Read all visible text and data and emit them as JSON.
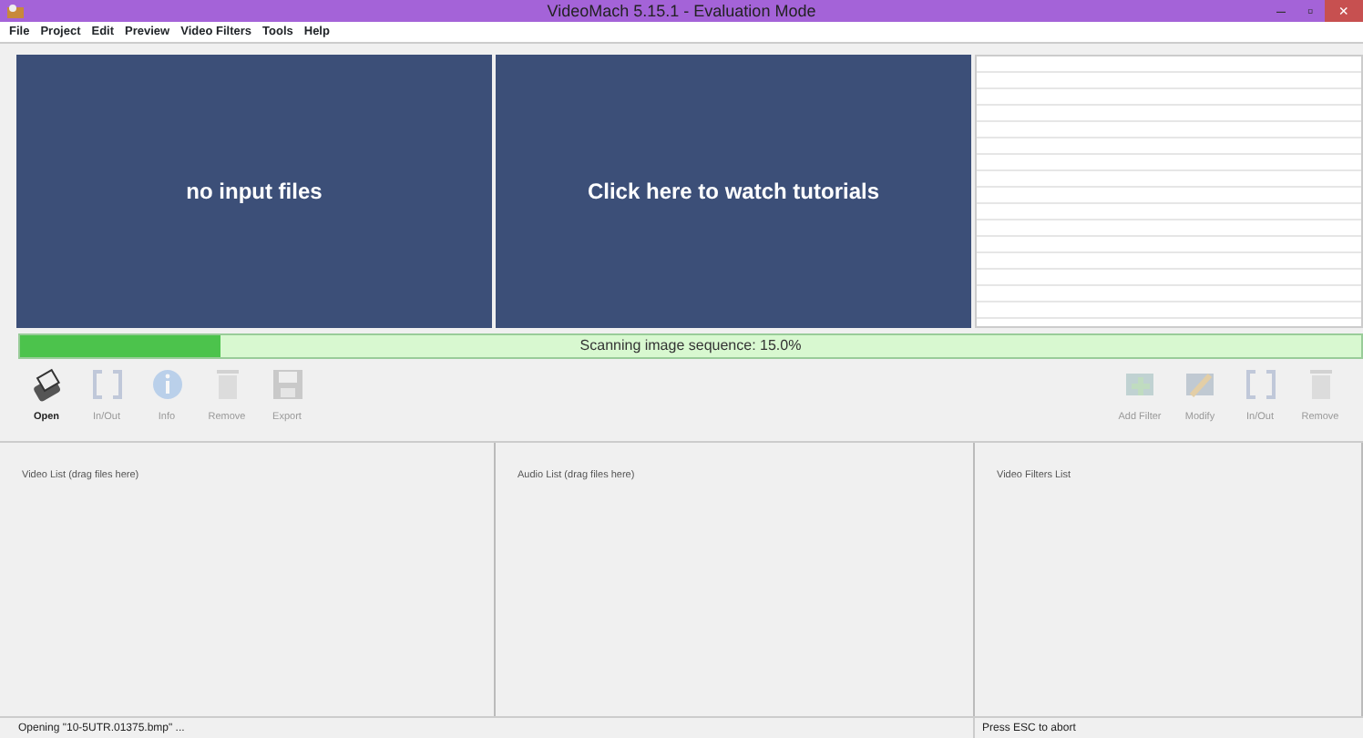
{
  "window": {
    "title": "VideoMach 5.15.1 - Evaluation Mode",
    "controls": [
      "–",
      "▫",
      "×"
    ]
  },
  "menu": [
    "File",
    "Project",
    "Edit",
    "Preview",
    "Video Filters",
    "Tools",
    "Help"
  ],
  "previews": [
    {
      "text": "no input files"
    },
    {
      "text": "Click here to watch tutorials"
    }
  ],
  "progress": {
    "level": 0.15,
    "text": "Scanning image sequence: 15.0%"
  },
  "toolbar_left": [
    {
      "label": "Open",
      "kind": "open",
      "disabled": false
    },
    {
      "label": "In/Out",
      "kind": "inout",
      "disabled": true
    },
    {
      "label": "Info",
      "kind": "info",
      "disabled": true
    },
    {
      "label": "Remove",
      "kind": "remove",
      "disabled": true
    },
    {
      "label": "Export",
      "kind": "export",
      "disabled": true
    }
  ],
  "toolbar_right": [
    {
      "label": "Add Filter",
      "kind": "addfilter",
      "disabled": true
    },
    {
      "label": "Modify",
      "kind": "modify",
      "disabled": true
    },
    {
      "label": "In/Out",
      "kind": "inout",
      "disabled": true
    },
    {
      "label": "Remove",
      "kind": "remove",
      "disabled": true
    }
  ],
  "lists": [
    "Video List (drag files here)",
    "Audio List (drag files here)",
    "Video Filters List"
  ],
  "status_bar": {
    "left": "Opening  \"10-5UTR.01375.bmp\" ...",
    "right": "Press ESC to abort"
  }
}
